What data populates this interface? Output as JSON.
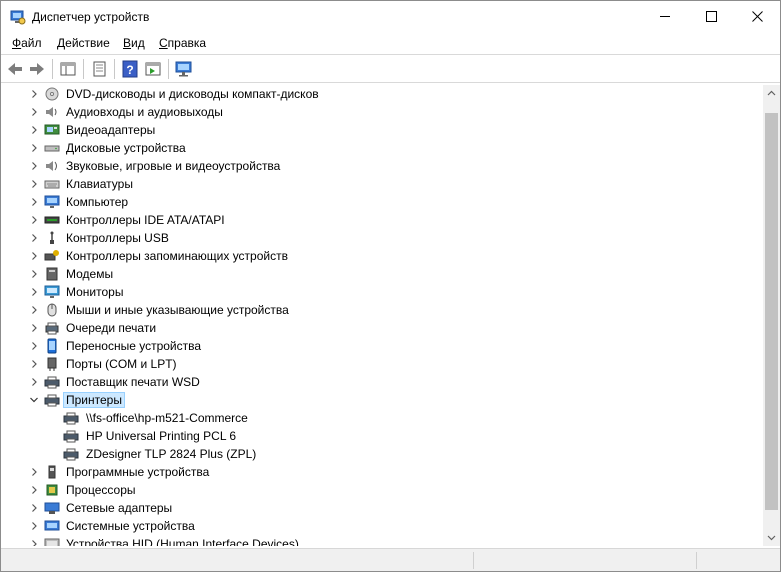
{
  "window": {
    "title": "Диспетчер устройств",
    "icon": "device-manager-icon"
  },
  "menu": [
    {
      "pre": "",
      "u": "Ф",
      "post": "айл"
    },
    {
      "pre": "",
      "u": "Д",
      "post": "ействие"
    },
    {
      "pre": "",
      "u": "В",
      "post": "ид"
    },
    {
      "pre": "",
      "u": "С",
      "post": "правка"
    }
  ],
  "toolbar": {
    "buttons": [
      "back-icon",
      "forward-icon",
      "properties-view-icon",
      "properties-icon",
      "help-icon",
      "details-view-icon",
      "scan-hardware-icon"
    ]
  },
  "tree": {
    "items": [
      {
        "label": "DVD-дисководы и дисководы компакт-дисков",
        "icon": "dvd-icon",
        "expanded": false
      },
      {
        "label": "Аудиовходы и аудиовыходы",
        "icon": "speaker-icon",
        "expanded": false
      },
      {
        "label": "Видеоадаптеры",
        "icon": "display-adapter-icon",
        "expanded": false
      },
      {
        "label": "Дисковые устройства",
        "icon": "disk-icon",
        "expanded": false
      },
      {
        "label": "Звуковые, игровые и видеоустройства",
        "icon": "sound-icon",
        "expanded": false
      },
      {
        "label": "Клавиатуры",
        "icon": "keyboard-icon",
        "expanded": false
      },
      {
        "label": "Компьютер",
        "icon": "computer-icon",
        "expanded": false
      },
      {
        "label": "Контроллеры IDE ATA/ATAPI",
        "icon": "ide-controller-icon",
        "expanded": false
      },
      {
        "label": "Контроллеры USB",
        "icon": "usb-icon",
        "expanded": false
      },
      {
        "label": "Контроллеры запоминающих устройств",
        "icon": "storage-controller-icon",
        "expanded": false
      },
      {
        "label": "Модемы",
        "icon": "modem-icon",
        "expanded": false
      },
      {
        "label": "Мониторы",
        "icon": "monitor-icon",
        "expanded": false
      },
      {
        "label": "Мыши и иные указывающие устройства",
        "icon": "mouse-icon",
        "expanded": false
      },
      {
        "label": "Очереди печати",
        "icon": "print-queue-icon",
        "expanded": false
      },
      {
        "label": "Переносные устройства",
        "icon": "portable-device-icon",
        "expanded": false
      },
      {
        "label": "Порты (COM и LPT)",
        "icon": "port-icon",
        "expanded": false
      },
      {
        "label": "Поставщик печати WSD",
        "icon": "printer-icon",
        "expanded": false
      },
      {
        "label": "Принтеры",
        "icon": "printer-icon",
        "expanded": true,
        "selected": true
      },
      {
        "label": "\\\\fs-office\\hp-m521-Commerce",
        "icon": "printer-icon",
        "child": true
      },
      {
        "label": "HP Universal Printing PCL 6",
        "icon": "printer-icon",
        "child": true
      },
      {
        "label": "ZDesigner TLP 2824 Plus (ZPL)",
        "icon": "printer-icon",
        "child": true
      },
      {
        "label": "Программные устройства",
        "icon": "software-device-icon",
        "expanded": false
      },
      {
        "label": "Процессоры",
        "icon": "processor-icon",
        "expanded": false
      },
      {
        "label": "Сетевые адаптеры",
        "icon": "network-adapter-icon",
        "expanded": false
      },
      {
        "label": "Системные устройства",
        "icon": "system-device-icon",
        "expanded": false
      },
      {
        "label": "Устройства HID (Human Interface Devices)",
        "icon": "hid-icon",
        "expanded": false
      }
    ]
  },
  "colors": {
    "selection_bg": "#cce8ff",
    "selection_border": "#99d1ff"
  }
}
